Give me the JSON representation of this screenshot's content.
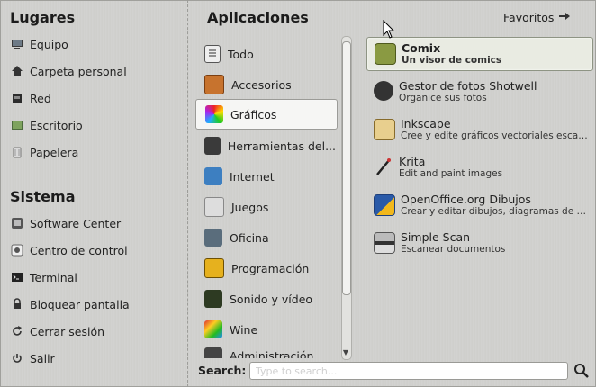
{
  "places": {
    "title": "Lugares",
    "items": [
      {
        "label": "Equipo",
        "icon": "computer-icon"
      },
      {
        "label": "Carpeta personal",
        "icon": "home-icon"
      },
      {
        "label": "Red",
        "icon": "network-icon"
      },
      {
        "label": "Escritorio",
        "icon": "desktop-icon"
      },
      {
        "label": "Papelera",
        "icon": "trash-icon"
      }
    ]
  },
  "system": {
    "title": "Sistema",
    "items": [
      {
        "label": "Software Center",
        "icon": "software-center-icon"
      },
      {
        "label": "Centro de control",
        "icon": "control-center-icon"
      },
      {
        "label": "Terminal",
        "icon": "terminal-icon"
      },
      {
        "label": "Bloquear pantalla",
        "icon": "lock-icon"
      },
      {
        "label": "Cerrar sesión",
        "icon": "logout-icon"
      },
      {
        "label": "Salir",
        "icon": "power-icon"
      }
    ]
  },
  "applications": {
    "title": "Aplicaciones",
    "favorites_label": "Favoritos",
    "categories": [
      {
        "label": "Todo",
        "icon": "all-apps-icon"
      },
      {
        "label": "Accesorios",
        "icon": "accessories-icon"
      },
      {
        "label": "Gráficos",
        "icon": "graphics-icon",
        "selected": true
      },
      {
        "label": "Herramientas del...",
        "icon": "system-tools-icon"
      },
      {
        "label": "Internet",
        "icon": "internet-icon"
      },
      {
        "label": "Juegos",
        "icon": "games-icon"
      },
      {
        "label": "Oficina",
        "icon": "office-icon"
      },
      {
        "label": "Programación",
        "icon": "programming-icon"
      },
      {
        "label": "Sonido y vídeo",
        "icon": "sound-video-icon"
      },
      {
        "label": "Wine",
        "icon": "wine-icon"
      },
      {
        "label": "Administración",
        "icon": "administration-icon"
      }
    ],
    "apps": [
      {
        "name": "Comix",
        "description": "Un visor de comics",
        "icon": "comix-icon",
        "selected": true
      },
      {
        "name": "Gestor de fotos Shotwell",
        "description": "Organice sus fotos",
        "icon": "shotwell-icon"
      },
      {
        "name": "Inkscape",
        "description": "Cree y edite gráficos vectoriales escalables",
        "icon": "inkscape-icon"
      },
      {
        "name": "Krita",
        "description": "Edit and paint images",
        "icon": "krita-icon"
      },
      {
        "name": "OpenOffice.org Dibujos",
        "description": "Crear y editar dibujos, diagramas de flujo y logotipos",
        "icon": "openoffice-draw-icon"
      },
      {
        "name": "Simple Scan",
        "description": "Escanear documentos",
        "icon": "scanner-icon"
      }
    ]
  },
  "search": {
    "label": "Search:",
    "value": "",
    "placeholder": "Type to search..."
  }
}
